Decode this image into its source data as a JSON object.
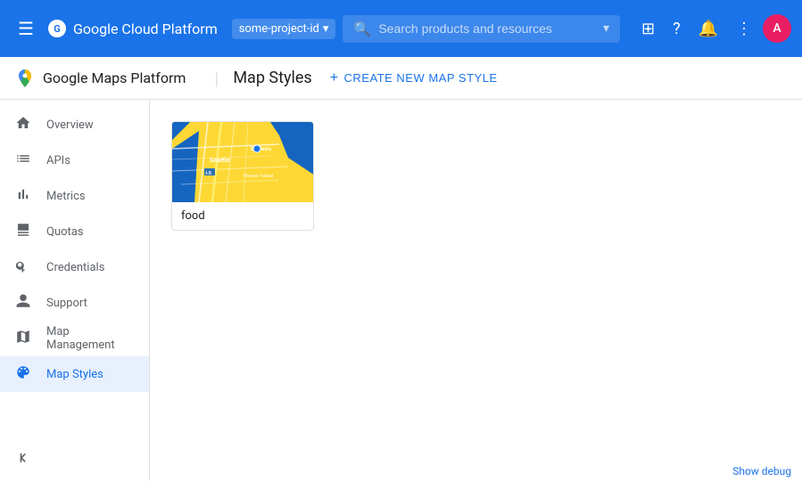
{
  "topNav": {
    "menuIcon": "☰",
    "appTitle": "Google Cloud Platform",
    "projectName": "some-project-id",
    "searchPlaceholder": "Search products and resources",
    "icons": {
      "apps": "⊞",
      "help": "?",
      "notifications": "🔔",
      "more": "⋮"
    },
    "avatarInitial": "A"
  },
  "subNav": {
    "brandName": "Google Maps Platform",
    "pageTitle": "Map Styles",
    "createButton": "CREATE NEW MAP STYLE"
  },
  "sidebar": {
    "items": [
      {
        "id": "overview",
        "label": "Overview",
        "icon": "home"
      },
      {
        "id": "apis",
        "label": "APIs",
        "icon": "list"
      },
      {
        "id": "metrics",
        "label": "Metrics",
        "icon": "bar_chart"
      },
      {
        "id": "quotas",
        "label": "Quotas",
        "icon": "monitor"
      },
      {
        "id": "credentials",
        "label": "Credentials",
        "icon": "vpn_key"
      },
      {
        "id": "support",
        "label": "Support",
        "icon": "person"
      },
      {
        "id": "map-management",
        "label": "Map Management",
        "icon": "map"
      },
      {
        "id": "map-styles",
        "label": "Map Styles",
        "icon": "palette",
        "active": true
      }
    ]
  },
  "mapStyles": {
    "cards": [
      {
        "id": "food",
        "label": "food",
        "thumbnail": "seattle-map"
      }
    ]
  },
  "bottomBar": {
    "debugLabel": "Show debug"
  }
}
